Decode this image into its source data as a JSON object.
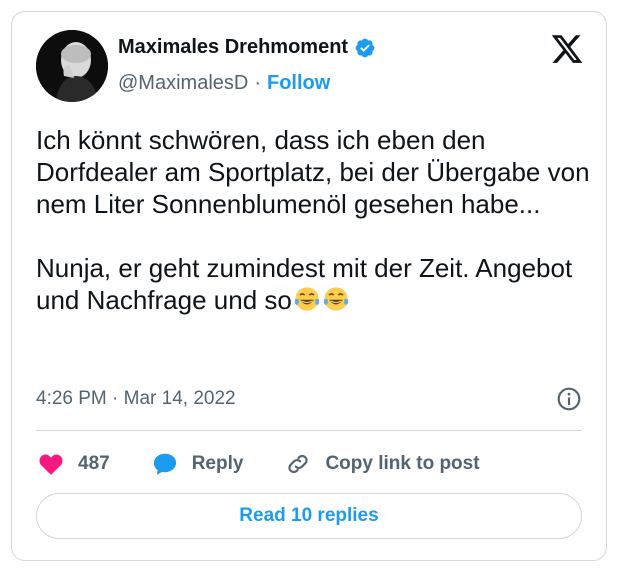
{
  "author": {
    "display_name": "Maximales Drehmoment",
    "handle": "@MaximalesD",
    "separator": "·",
    "follow_label": "Follow",
    "verified": true
  },
  "tweet": {
    "text": "Ich könnt schwören, dass ich eben den Dorfdealer am Sportplatz, bei der Übergabe von nem Liter Sonnenblumenöl gesehen habe...\n\nNunja, er geht zumindest mit der Zeit. Angebot und Nachfrage und so",
    "emojis": [
      "tears-of-joy",
      "tears-of-joy"
    ],
    "timestamp": "4:26 PM · Mar 14, 2022"
  },
  "actions": {
    "likes": "487",
    "reply_label": "Reply",
    "copy_link_label": "Copy link to post"
  },
  "read_replies_label": "Read 10 replies",
  "colors": {
    "accent": "#1d9bf0",
    "like": "#f91880",
    "text": "#0f1419",
    "muted": "#536471",
    "border": "#cfd9de"
  }
}
